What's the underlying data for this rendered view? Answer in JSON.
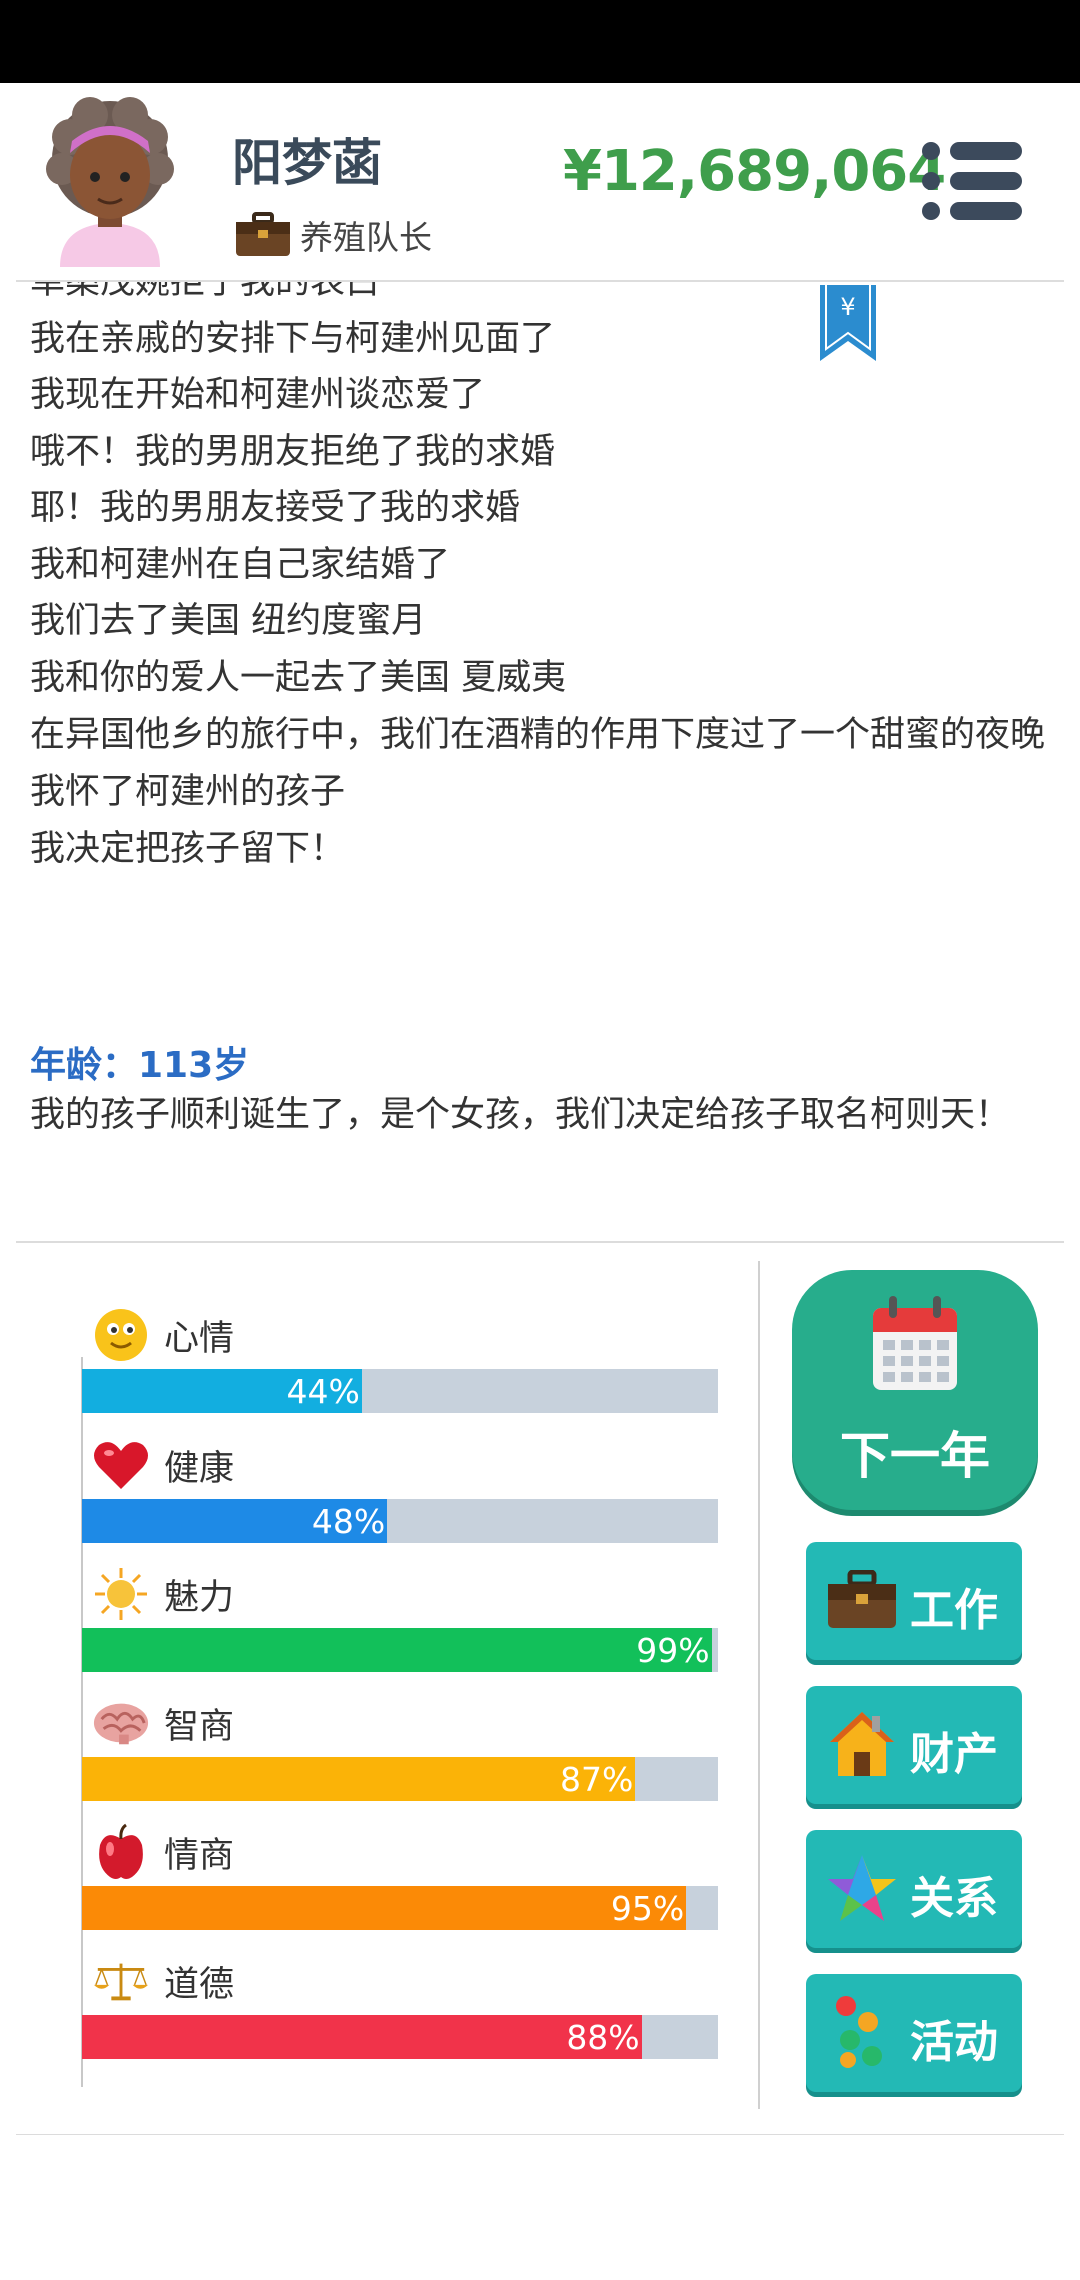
{
  "player": {
    "name": "阳梦菡",
    "job": "养殖队长",
    "money": "¥12,689,064"
  },
  "bookmark_symbol": "¥",
  "log": [
    "单桑茂婉拒了我的表白",
    "我在亲戚的安排下与柯建州见面了",
    "我现在开始和柯建州谈恋爱了",
    "哦不！我的男朋友拒绝了我的求婚",
    "耶！我的男朋友接受了我的求婚",
    "我和柯建州在自己家结婚了",
    "我们去了美国 纽约度蜜月",
    "我和你的爱人一起去了美国 夏威夷",
    "在异国他乡的旅行中，我们在酒精的作用下度过了一个甜蜜的夜晚",
    "我怀了柯建州的孩子",
    "我决定把孩子留下！"
  ],
  "age_label": "年龄：113岁",
  "current_event": "我的孩子顺利诞生了，是个女孩，我们决定给孩子取名柯则天！",
  "stats": [
    {
      "label": "心情",
      "percent": 44,
      "percent_text": "44%",
      "color": "#12aee0",
      "icon": "smiley-icon"
    },
    {
      "label": "健康",
      "percent": 48,
      "percent_text": "48%",
      "color": "#1e8ae6",
      "icon": "heart-icon"
    },
    {
      "label": "魅力",
      "percent": 99,
      "percent_text": "99%",
      "color": "#12c05a",
      "icon": "sun-icon"
    },
    {
      "label": "智商",
      "percent": 87,
      "percent_text": "87%",
      "color": "#fbb307",
      "icon": "brain-icon"
    },
    {
      "label": "情商",
      "percent": 95,
      "percent_text": "95%",
      "color": "#fb8a06",
      "icon": "apple-icon"
    },
    {
      "label": "道德",
      "percent": 88,
      "percent_text": "88%",
      "color": "#f1334a",
      "icon": "scales-icon"
    }
  ],
  "buttons": {
    "next_year": "下一年",
    "work": "工作",
    "property": "财产",
    "relations": "关系",
    "activities": "活动"
  },
  "colors": {
    "money": "#3f9e4c",
    "age": "#2b6cc4",
    "next_year_bg": "#27ad8c",
    "side_button_bg": "#23b9b5"
  }
}
